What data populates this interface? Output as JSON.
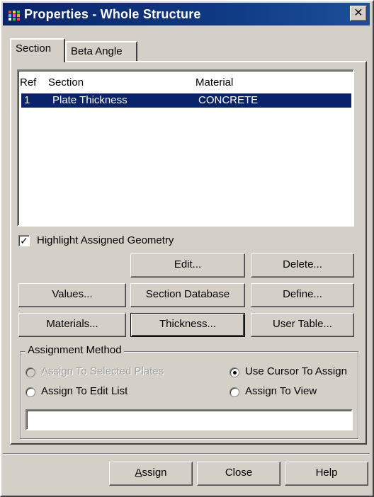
{
  "window": {
    "title": "Properties - Whole Structure",
    "close_glyph": "✕"
  },
  "tabs": [
    {
      "label": "Section",
      "active": true
    },
    {
      "label": "Beta Angle",
      "active": false
    }
  ],
  "section_list": {
    "columns": [
      "Ref",
      "Section",
      "Material"
    ],
    "rows": [
      {
        "ref": "1",
        "section": "Plate Thickness",
        "material": "CONCRETE",
        "selected": true
      }
    ]
  },
  "highlight_checkbox": {
    "label": "Highlight Assigned Geometry",
    "checked": true,
    "check_glyph": "✓"
  },
  "buttons": {
    "edit": "Edit...",
    "delete": "Delete...",
    "values": "Values...",
    "section_database": "Section Database",
    "define": "Define...",
    "materials": "Materials...",
    "thickness": "Thickness...",
    "user_table": "User Table..."
  },
  "assignment_method": {
    "label": "Assignment Method",
    "options": [
      {
        "label": "Assign To Selected Plates",
        "enabled": false,
        "selected": false
      },
      {
        "label": "Use Cursor To Assign",
        "enabled": true,
        "selected": true
      },
      {
        "label": "Assign To Edit List",
        "enabled": true,
        "selected": false
      },
      {
        "label": "Assign To View",
        "enabled": true,
        "selected": false
      }
    ],
    "edit_list_value": ""
  },
  "footer_buttons": {
    "assign_prefix": "A",
    "assign_rest": "ssign",
    "close": "Close",
    "help": "Help"
  },
  "colors": {
    "titlebar": "#0a246a",
    "dialog_face": "#d4d0c8",
    "selection": "#0a246a"
  }
}
